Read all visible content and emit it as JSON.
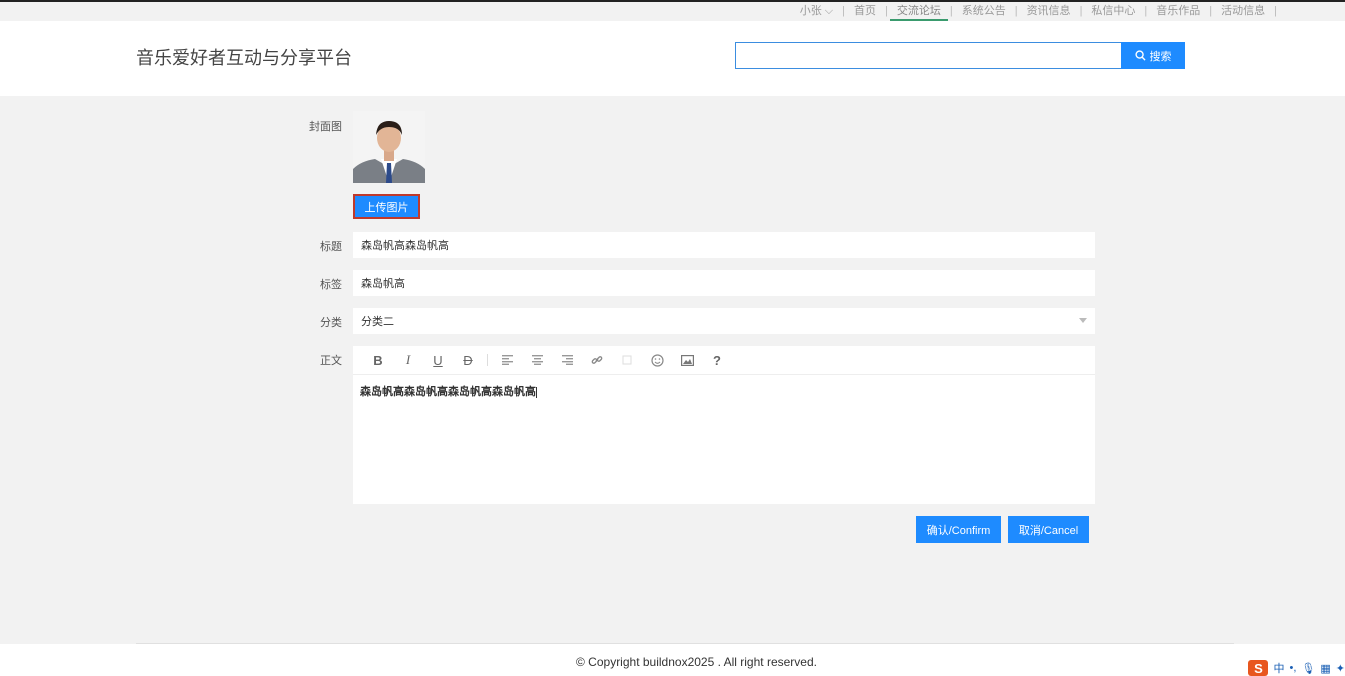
{
  "topnav": {
    "user": "小张",
    "items": [
      "首页",
      "交流论坛",
      "系统公告",
      "资讯信息",
      "私信中心",
      "音乐作品",
      "活动信息"
    ],
    "active_index": 1
  },
  "header": {
    "site_title": "音乐爱好者互动与分享平台",
    "search_value": "",
    "search_button": "搜索"
  },
  "form": {
    "cover_label": "封面图",
    "upload_button": "上传图片",
    "title_label": "标题",
    "title_value": "森岛帆高森岛帆高",
    "tag_label": "标签",
    "tag_value": "森岛帆高",
    "category_label": "分类",
    "category_value": "分类二",
    "content_label": "正文",
    "content_value": "森岛帆高森岛帆高森岛帆高森岛帆高"
  },
  "editor_toolbar": [
    "bold-icon",
    "italic-icon",
    "underline-icon",
    "strikethrough-icon",
    "align-left-icon",
    "align-center-icon",
    "align-right-icon",
    "link-icon",
    "unlink-icon",
    "emoji-icon",
    "image-icon",
    "help-icon"
  ],
  "buttons": {
    "confirm": "确认/Confirm",
    "cancel": "取消/Cancel"
  },
  "footer": {
    "copyright": "© Copyright buildnox2025 . All right reserved."
  },
  "ime": {
    "logo": "S",
    "mode": "中"
  },
  "colors": {
    "primary": "#1e8bff",
    "active_underline": "#3a9b6e",
    "background": "#f2f2f2"
  }
}
